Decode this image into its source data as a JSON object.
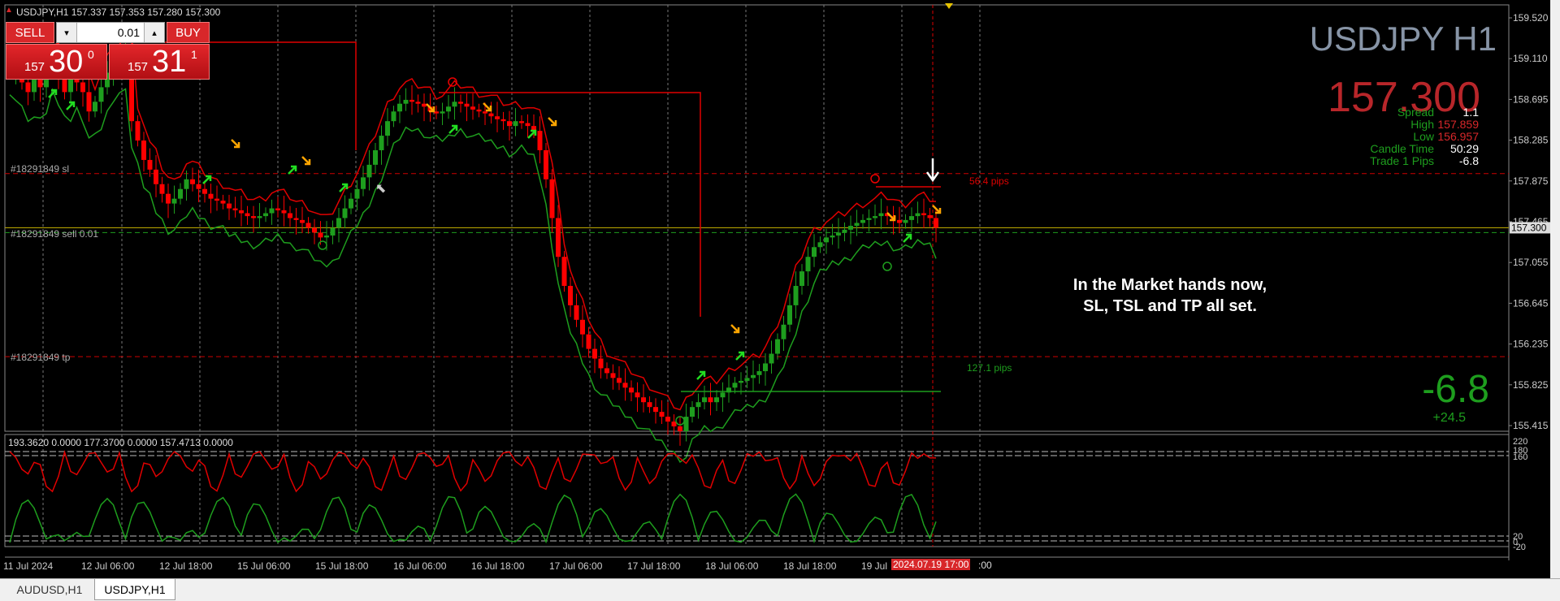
{
  "window": {
    "info_line": "USDJPY,H1  157.337 157.353 157.280 157.300"
  },
  "trade_panel": {
    "sell_label": "SELL",
    "buy_label": "BUY",
    "lot": "0.01",
    "sell_price": {
      "prefix": "157",
      "big": "30",
      "sup": "0"
    },
    "buy_price": {
      "prefix": "157",
      "big": "31",
      "sup": "1"
    }
  },
  "overlay": {
    "symbol_title": "USDJPY H1",
    "price": "157.300",
    "stats": [
      {
        "label": "Spread",
        "value": "1.1",
        "value_color": "#ffffff"
      },
      {
        "label": "High",
        "value": "157.859",
        "value_color": "#d8272a"
      },
      {
        "label": "Low",
        "value": "156.957",
        "value_color": "#d8272a"
      },
      {
        "label": "Candle Time",
        "value": "50:29",
        "value_color": "#ffffff"
      },
      {
        "label": "Trade 1 Pips",
        "value": "-6.8",
        "value_color": "#ffffff"
      }
    ],
    "pnl_big": "-6.8",
    "pnl_small": "+24.5",
    "annotation": [
      "In the Market hands now,",
      "SL, TSL and TP all set."
    ]
  },
  "order_lines": {
    "sl_label": "#18291849 sl",
    "sell_label": "#18291849 sell 0.01",
    "tp_label": "#18291849 tp",
    "sl_pips": "56.4 pips",
    "tp_pips": "127.1 pips"
  },
  "indicator": {
    "header": "193.3620 0.0000 177.3700 0.0000 157.4713 0.0000",
    "levels": [
      "220",
      "180",
      "160",
      "20",
      "0",
      "-20"
    ]
  },
  "time_axis": {
    "labels": [
      "11 Jul 2024",
      "12 Jul 06:00",
      "12 Jul 18:00",
      "15 Jul 06:00",
      "15 Jul 18:00",
      "16 Jul 06:00",
      "16 Jul 18:00",
      "17 Jul 06:00",
      "17 Jul 18:00",
      "18 Jul 06:00",
      "18 Jul 18:00",
      "19 Jul"
    ],
    "highlight": "2024.07.19 17:00",
    "after_highlight": ":00"
  },
  "tabs": [
    {
      "label": "AUDUSD,H1",
      "active": false
    },
    {
      "label": "USDJPY,H1",
      "active": true
    }
  ],
  "colors": {
    "bull": "#1e9e1e",
    "bear": "#ff0000",
    "current_price": "#c8b400",
    "axis_highlight": "#d8272a"
  },
  "chart_data": {
    "type": "candlestick",
    "price_axis": {
      "min": 155.2,
      "max": 159.6,
      "ticks": [
        "159.520",
        "159.110",
        "158.695",
        "158.285",
        "157.875",
        "157.465",
        "157.055",
        "156.645",
        "156.235",
        "155.825",
        "155.415"
      ],
      "current": "157.300"
    },
    "levels": {
      "sl": 157.859,
      "entry": 157.3,
      "tp": 155.97
    },
    "close": [
      158.9,
      159.0,
      158.8,
      158.7,
      158.9,
      158.75,
      158.95,
      159.05,
      158.85,
      158.7,
      158.9,
      158.8,
      158.7,
      158.5,
      158.6,
      158.75,
      158.9,
      158.95,
      159.05,
      159.1,
      158.4,
      158.2,
      158.0,
      157.9,
      157.75,
      157.65,
      157.55,
      157.6,
      157.7,
      157.8,
      157.75,
      157.7,
      157.65,
      157.6,
      157.58,
      157.55,
      157.5,
      157.48,
      157.45,
      157.42,
      157.4,
      157.42,
      157.45,
      157.5,
      157.48,
      157.45,
      157.4,
      157.38,
      157.35,
      157.3,
      157.25,
      157.2,
      157.22,
      157.3,
      157.4,
      157.5,
      157.6,
      157.7,
      157.82,
      157.95,
      158.1,
      158.25,
      158.4,
      158.5,
      158.58,
      158.62,
      158.6,
      158.58,
      158.55,
      158.5,
      158.48,
      158.5,
      158.55,
      158.6,
      158.58,
      158.55,
      158.52,
      158.5,
      158.48,
      158.45,
      158.42,
      158.4,
      158.35,
      158.4,
      158.38,
      158.35,
      158.3,
      158.1,
      157.8,
      157.4,
      157.0,
      156.7,
      156.5,
      156.35,
      156.2,
      156.05,
      155.95,
      155.85,
      155.8,
      155.75,
      155.7,
      155.65,
      155.6,
      155.55,
      155.5,
      155.45,
      155.4,
      155.35,
      155.3,
      155.25,
      155.2,
      155.35,
      155.45,
      155.5,
      155.55,
      155.5,
      155.55,
      155.6,
      155.65,
      155.7,
      155.72,
      155.75,
      155.78,
      155.82,
      155.9,
      156.0,
      156.15,
      156.3,
      156.5,
      156.7,
      156.85,
      157.0,
      157.1,
      157.15,
      157.2,
      157.22,
      157.25,
      157.28,
      157.32,
      157.35,
      157.38,
      157.4,
      157.42,
      157.45,
      157.42,
      157.38,
      157.35,
      157.38,
      157.42,
      157.45,
      157.43,
      157.4,
      157.3
    ]
  }
}
